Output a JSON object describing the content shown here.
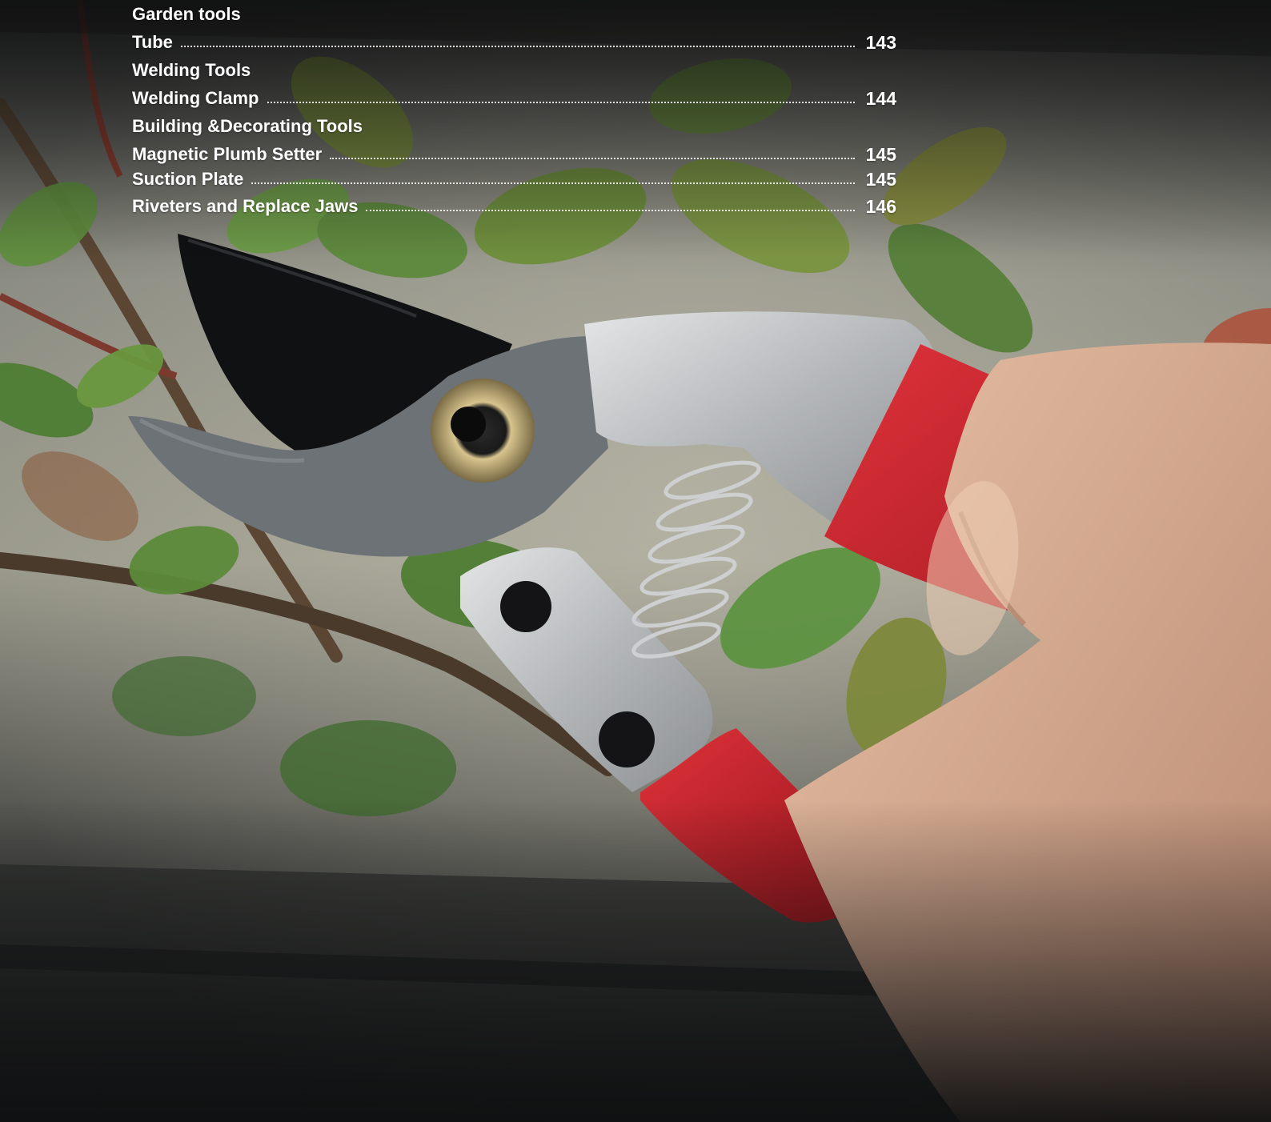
{
  "toc": {
    "entries": [
      {
        "type": "heading",
        "label": "Garden tools"
      },
      {
        "type": "item",
        "label": "Tube",
        "page": "143"
      },
      {
        "type": "heading",
        "label": "Welding Tools"
      },
      {
        "type": "item",
        "label": "Welding Clamp",
        "page": "144"
      },
      {
        "type": "heading",
        "label": "Building &Decorating Tools"
      },
      {
        "type": "item",
        "label": "Magnetic Plumb Setter",
        "page": "145"
      },
      {
        "type": "item",
        "label": "Suction Plate",
        "page": "145"
      },
      {
        "type": "item",
        "label": "Riveters and Replace Jaws",
        "page": "146"
      }
    ]
  },
  "photo": {
    "subject": "pruning-shears-icon",
    "colors": {
      "handle_red": "#c8202a",
      "metal_silver": "#bfc2c4",
      "blade_black": "#111214",
      "leaf_green": "#5d8a3c",
      "background_dark": "#1b1c1e"
    }
  }
}
